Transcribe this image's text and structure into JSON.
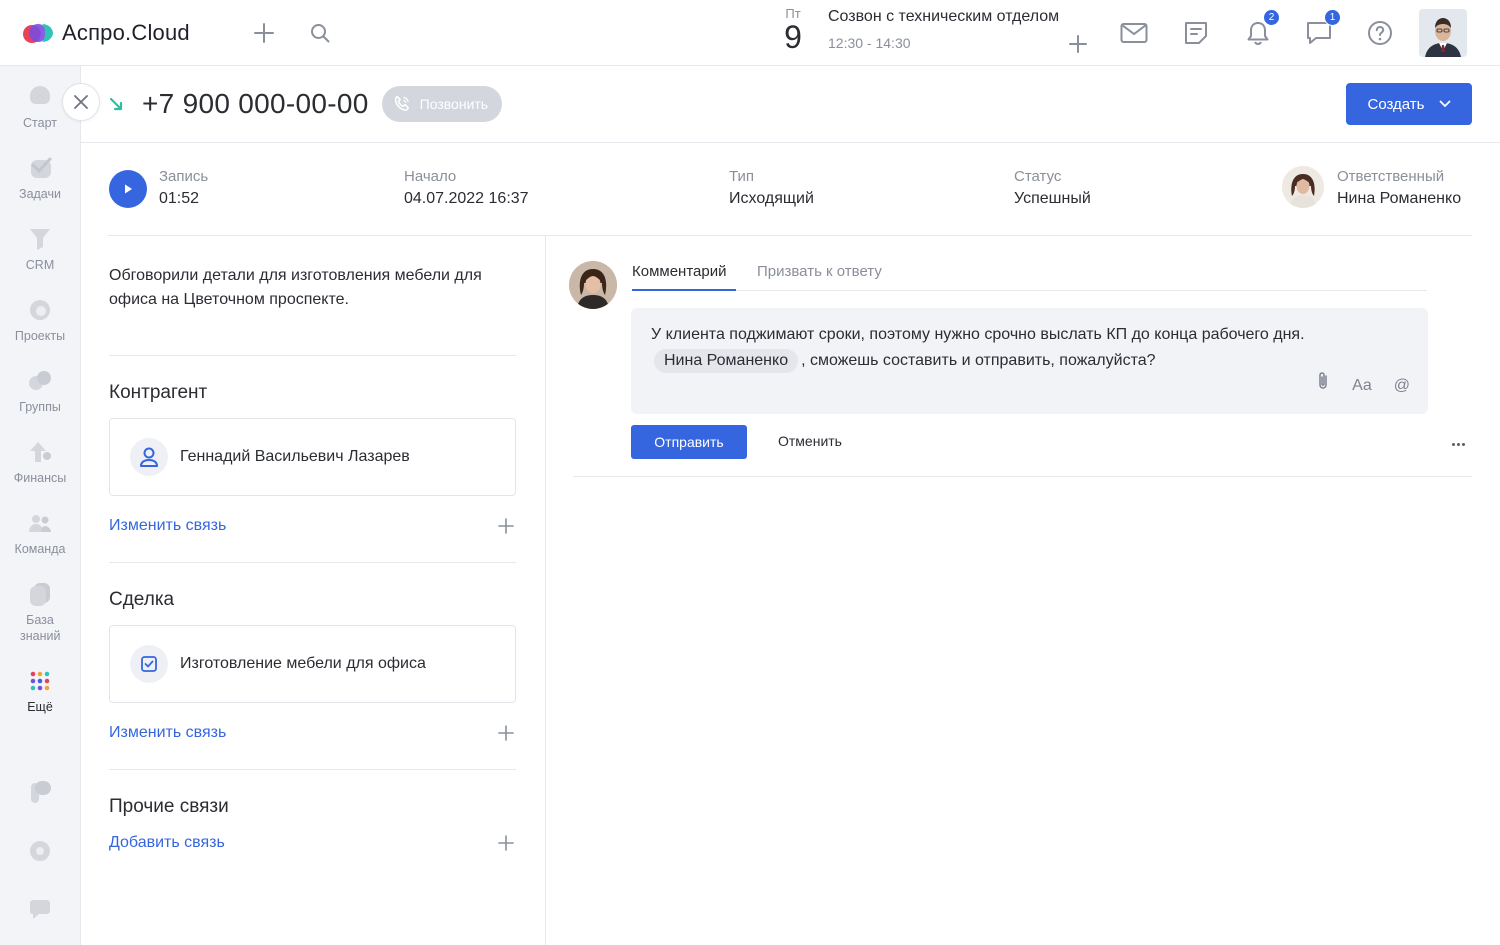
{
  "app": {
    "logo_text": "Аспро.Cloud"
  },
  "header": {
    "calendar": {
      "day_of_week": "Пт",
      "day": "9"
    },
    "event": {
      "title": "Созвон с техническим отделом",
      "time": "12:30 - 14:30"
    },
    "notifications_badge": "2",
    "chat_badge": "1"
  },
  "sidebar": {
    "items": [
      {
        "label": "Старт",
        "icon": "heart-icon"
      },
      {
        "label": "Задачи",
        "icon": "check-icon"
      },
      {
        "label": "CRM",
        "icon": "funnel-icon"
      },
      {
        "label": "Проекты",
        "icon": "projects-icon"
      },
      {
        "label": "Группы",
        "icon": "groups-icon"
      },
      {
        "label": "Финансы",
        "icon": "finance-icon"
      },
      {
        "label": "Команда",
        "icon": "team-icon"
      },
      {
        "label": "База знаний",
        "icon": "knowledge-icon"
      },
      {
        "label": "Ещё",
        "icon": "more-grid-icon"
      }
    ]
  },
  "call": {
    "phone": "+7 900 000-00-00",
    "call_button": "Позвонить",
    "create_button": "Создать"
  },
  "meta": {
    "record_label": "Запись",
    "record_value": "01:52",
    "start_label": "Начало",
    "start_value": "04.07.2022 16:37",
    "type_label": "Тип",
    "type_value": "Исходящий",
    "status_label": "Статус",
    "status_value": "Успешный",
    "responsible_label": "Ответственный",
    "responsible_value": "Нина Романенко"
  },
  "description": "Обговорили детали для изготовления мебели для офиса на Цветочном проспекте.",
  "links": {
    "counterparty_title": "Контрагент",
    "counterparty_name": "Геннадий Васильевич Лазарев",
    "counterparty_change": "Изменить связь",
    "deal_title": "Сделка",
    "deal_name": "Изготовление мебели для офиса",
    "deal_change": "Изменить связь",
    "other_title": "Прочие связи",
    "other_add": "Добавить связь"
  },
  "comments": {
    "tab_comment": "Комментарий",
    "tab_call_to_answer": "Призвать к ответу",
    "text_before": "У клиента поджимают сроки, поэтому нужно срочно выслать КП до конца рабочего дня.",
    "mention": "Нина Романенко",
    "text_after": ", сможешь составить и отправить, пожалуйста?",
    "format_label": "Aa",
    "mention_symbol": "@",
    "send_button": "Отправить",
    "cancel_button": "Отменить"
  },
  "colors": {
    "accent": "#3566e0",
    "call_arrow": "#2fbf9c"
  }
}
